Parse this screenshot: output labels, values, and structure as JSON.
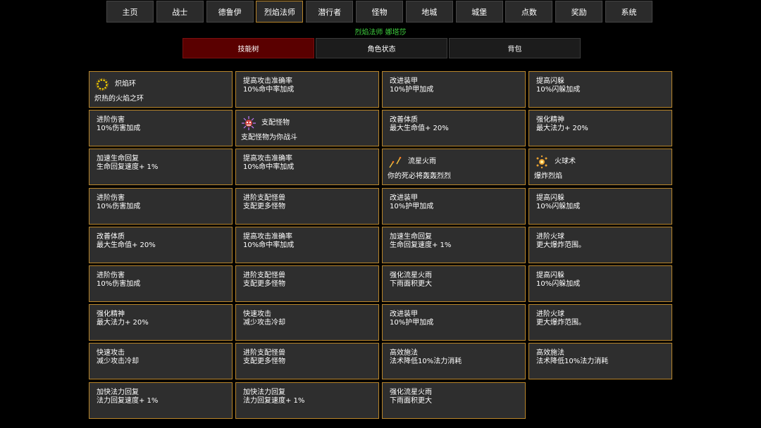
{
  "nav": {
    "tabs": [
      "主页",
      "战士",
      "德鲁伊",
      "烈焰法师",
      "潜行者",
      "怪物",
      "地城",
      "城堡",
      "点数",
      "奖励",
      "系统"
    ],
    "active_index": 3
  },
  "character": {
    "title": "烈焰法师 娜塔莎"
  },
  "subtabs": {
    "tabs": [
      "技能树",
      "角色状态",
      "背包"
    ],
    "active_index": 0
  },
  "colors": {
    "accent_border": "#b8852a",
    "title_green": "#3fd13f",
    "active_subtab": "#5a0000"
  },
  "cells": [
    {
      "name": "炽焰环",
      "desc": "炽热的火焰之环",
      "icon": "fire-ring-icon"
    },
    {
      "name": "提高攻击准确率",
      "desc": "10%命中率加成"
    },
    {
      "name": "改进装甲",
      "desc": "10%护甲加成"
    },
    {
      "name": "提高闪躲",
      "desc": "10%闪躲加成"
    },
    {
      "name": "进阶伤害",
      "desc": "10%伤害加成"
    },
    {
      "name": "支配怪物",
      "desc": "支配怪物为你战斗",
      "icon": "dominate-monster-icon"
    },
    {
      "name": "改善体质",
      "desc": "最大生命值+ 20%"
    },
    {
      "name": "强化精神",
      "desc": "最大法力+ 20%"
    },
    {
      "name": "加速生命回复",
      "desc": "生命回复速度+ 1%"
    },
    {
      "name": "提高攻击准确率",
      "desc": "10%命中率加成"
    },
    {
      "name": "流星火雨",
      "desc": "你的死必将轰轰烈烈",
      "icon": "meteor-shower-icon"
    },
    {
      "name": "火球术",
      "desc": "爆炸烈焰",
      "icon": "fireball-icon"
    },
    {
      "name": "进阶伤害",
      "desc": "10%伤害加成"
    },
    {
      "name": "进阶支配怪兽",
      "desc": "支配更多怪物"
    },
    {
      "name": "改进装甲",
      "desc": "10%护甲加成"
    },
    {
      "name": "提高闪躲",
      "desc": "10%闪躲加成"
    },
    {
      "name": "改善体质",
      "desc": "最大生命值+ 20%"
    },
    {
      "name": "提高攻击准确率",
      "desc": "10%命中率加成"
    },
    {
      "name": "加速生命回复",
      "desc": "生命回复速度+ 1%"
    },
    {
      "name": "进阶火球",
      "desc": "更大爆炸范围。"
    },
    {
      "name": "进阶伤害",
      "desc": "10%伤害加成"
    },
    {
      "name": "进阶支配怪兽",
      "desc": "支配更多怪物"
    },
    {
      "name": "强化流星火雨",
      "desc": "下雨面积更大"
    },
    {
      "name": "提高闪躲",
      "desc": "10%闪躲加成"
    },
    {
      "name": "强化精神",
      "desc": "最大法力+ 20%"
    },
    {
      "name": "快速攻击",
      "desc": "减少攻击冷却"
    },
    {
      "name": "改进装甲",
      "desc": "10%护甲加成"
    },
    {
      "name": "进阶火球",
      "desc": "更大爆炸范围。"
    },
    {
      "name": "快速攻击",
      "desc": "减少攻击冷却"
    },
    {
      "name": "进阶支配怪兽",
      "desc": "支配更多怪物"
    },
    {
      "name": "高效施法",
      "desc": "法术降低10%法力消耗"
    },
    {
      "name": "高效施法",
      "desc": "法术降低10%法力消耗"
    },
    {
      "name": "加快法力回复",
      "desc": "法力回复速度+ 1%"
    },
    {
      "name": "加快法力回复",
      "desc": "法力回复速度+ 1%"
    },
    {
      "name": "强化流星火雨",
      "desc": "下雨面积更大"
    }
  ]
}
